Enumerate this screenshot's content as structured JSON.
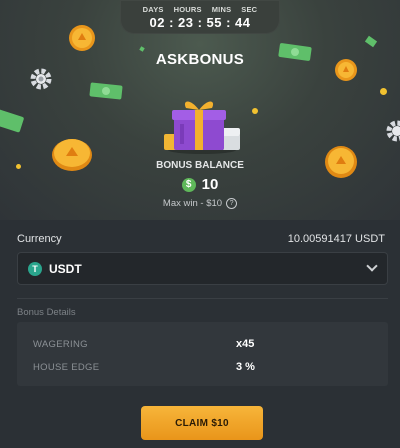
{
  "timer": {
    "labels": {
      "days": "DAYS",
      "hours": "HOURS",
      "mins": "MINS",
      "sec": "SEC"
    },
    "value": "02 : 23 : 55 : 44"
  },
  "title": "ASKBONUS",
  "bonus": {
    "label": "BONUS BALANCE",
    "coin_symbol": "$",
    "amount": "10",
    "max_win": "Max win - $10",
    "info_symbol": "?"
  },
  "currency": {
    "label": "Currency",
    "balance": "10.00591417 USDT",
    "selected": "USDT",
    "token_symbol": "T"
  },
  "details": {
    "title": "Bonus Details",
    "rows": [
      {
        "label": "WAGERING",
        "value": "x45"
      },
      {
        "label": "HOUSE EDGE",
        "value": "3 %"
      }
    ]
  },
  "claim_button": "CLAIM $10",
  "colors": {
    "accent": "#f0a52b",
    "usdt": "#2aa58d",
    "coin": "#5fb85a",
    "background": "#2b3035"
  }
}
